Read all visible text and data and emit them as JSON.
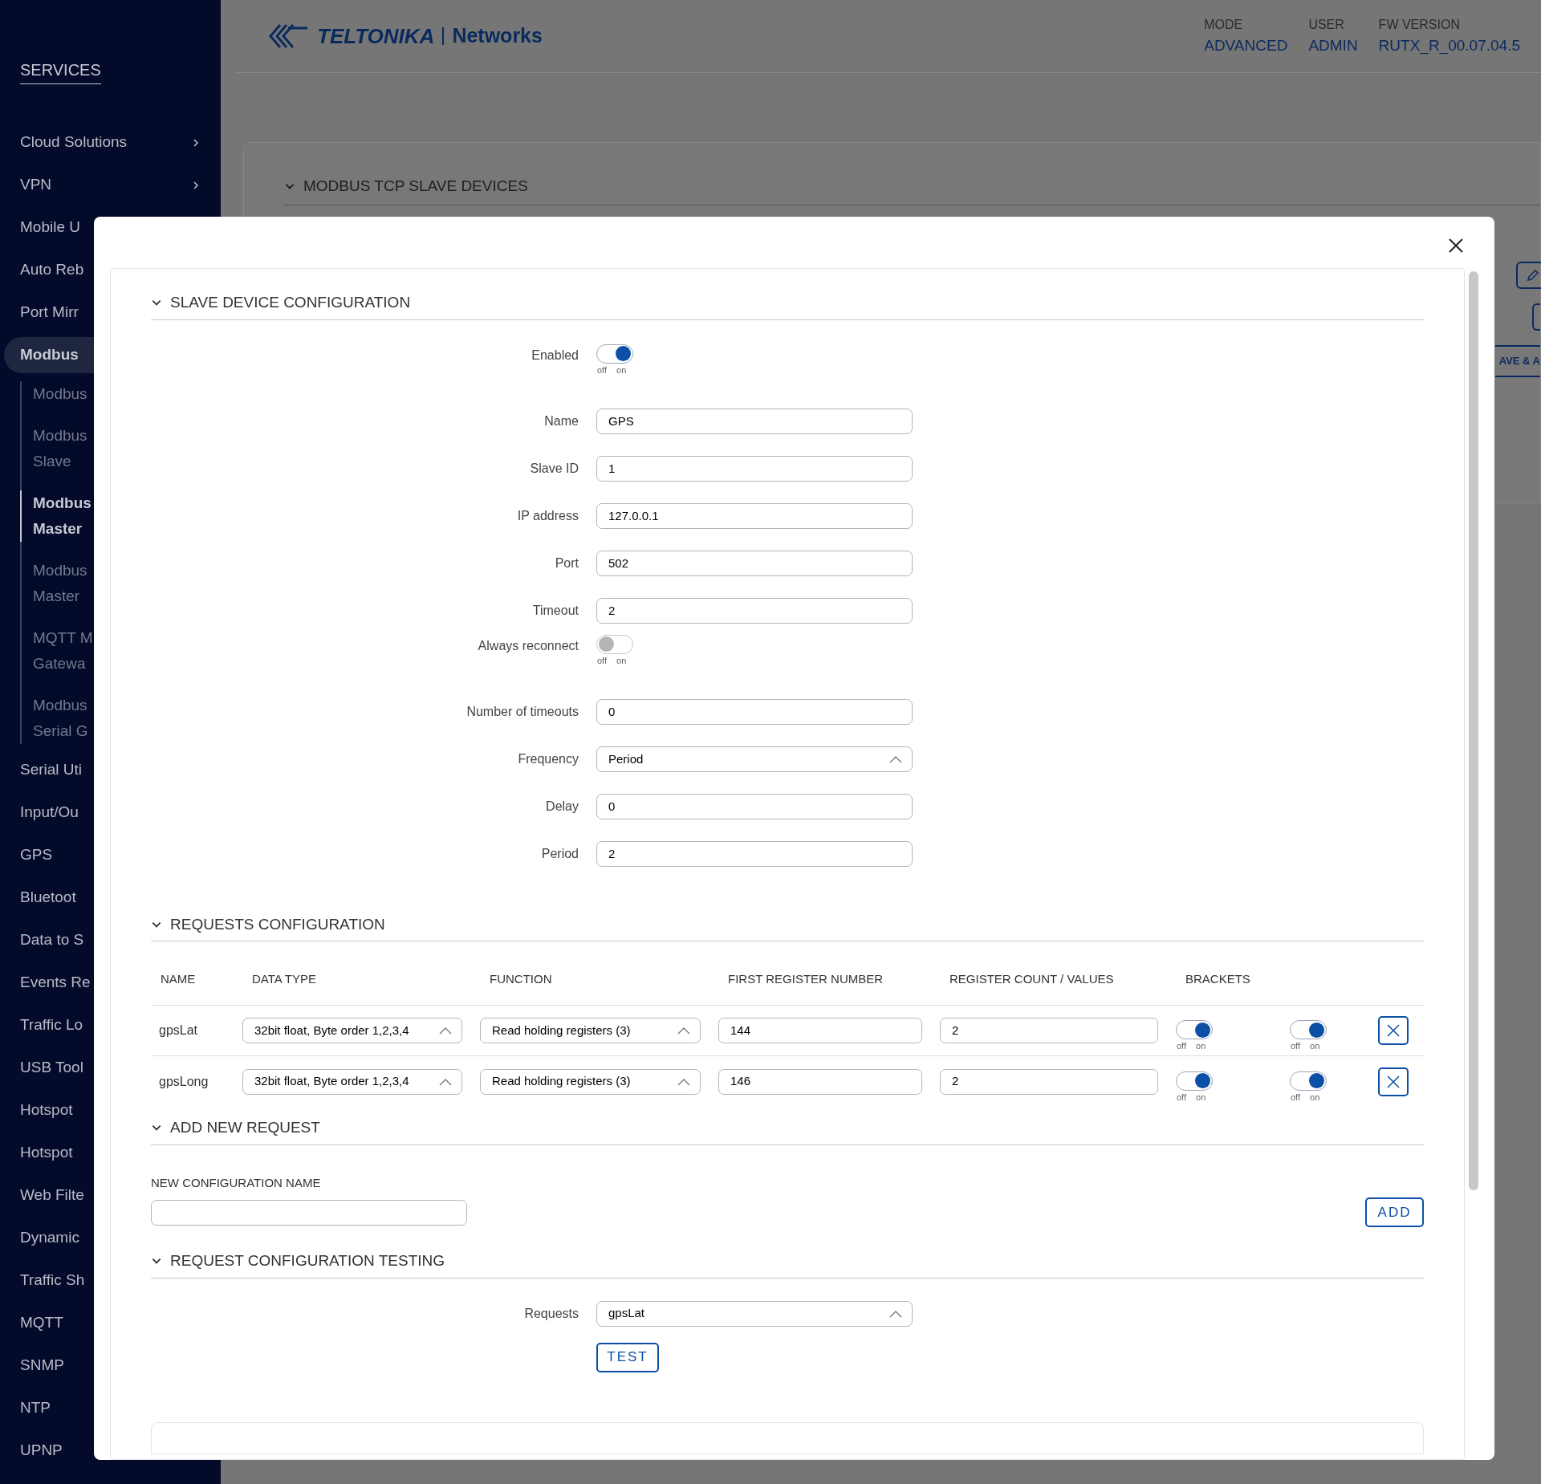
{
  "sidebar": {
    "section": "SERVICES",
    "items": [
      {
        "label": "Cloud Solutions",
        "chevron": true,
        "selected": false
      },
      {
        "label": "VPN",
        "chevron": true,
        "selected": false
      },
      {
        "label": "Mobile U",
        "selected": false
      },
      {
        "label": "Auto Reb",
        "selected": false
      },
      {
        "label": "Port Mirr",
        "selected": false
      },
      {
        "label": "Modbus",
        "selected": true,
        "children": [
          {
            "label": "Modbus",
            "selected": false
          },
          {
            "label": "Modbus\nSlave",
            "selected": false
          },
          {
            "label": "Modbus\nMaster",
            "selected": true
          },
          {
            "label": "Modbus\nMaster",
            "selected": false
          },
          {
            "label": "MQTT M\nGatewa",
            "selected": false
          },
          {
            "label": "Modbus\nSerial G",
            "selected": false
          }
        ]
      },
      {
        "label": "Serial Uti",
        "selected": false
      },
      {
        "label": "Input/Ou",
        "selected": false
      },
      {
        "label": "GPS",
        "selected": false
      },
      {
        "label": "Bluetoot",
        "selected": false
      },
      {
        "label": "Data to S",
        "selected": false
      },
      {
        "label": "Events Re",
        "selected": false
      },
      {
        "label": "Traffic Lo",
        "selected": false
      },
      {
        "label": "USB Tool",
        "selected": false
      },
      {
        "label": "Hotspot",
        "selected": false
      },
      {
        "label": "Hotspot",
        "selected": false
      },
      {
        "label": "Web Filte",
        "selected": false
      },
      {
        "label": "Dynamic",
        "selected": false
      },
      {
        "label": "Traffic Sh",
        "selected": false
      },
      {
        "label": "MQTT",
        "selected": false
      },
      {
        "label": "SNMP",
        "selected": false
      },
      {
        "label": "NTP",
        "selected": false
      },
      {
        "label": "UPNP",
        "selected": false
      }
    ]
  },
  "header": {
    "logo": {
      "brand": "TELTONIKA",
      "product": "Networks"
    },
    "info": [
      {
        "label": "MODE",
        "value": "ADVANCED"
      },
      {
        "label": "USER",
        "value": "ADMIN"
      },
      {
        "label": "FW VERSION",
        "value": "RUTX_R_00.07.04.5"
      }
    ]
  },
  "background_card": {
    "title": "MODBUS TCP SLAVE DEVICES",
    "expanded": true,
    "partial_button": "AVE & A"
  },
  "modal": {
    "slave_config": {
      "title": "SLAVE DEVICE CONFIGURATION",
      "expanded": true,
      "fields": [
        {
          "label": "Enabled",
          "kind": "toggle",
          "on": true,
          "off_label": "off",
          "on_label": "on"
        },
        {
          "label": "Name",
          "kind": "text",
          "value": "GPS"
        },
        {
          "label": "Slave ID",
          "kind": "text",
          "value": "1"
        },
        {
          "label": "IP address",
          "kind": "text",
          "value": "127.0.0.1"
        },
        {
          "label": "Port",
          "kind": "text",
          "value": "502"
        },
        {
          "label": "Timeout",
          "kind": "text",
          "value": "2"
        },
        {
          "label": "Always reconnect",
          "kind": "toggle",
          "on": false,
          "off_label": "off",
          "on_label": "on"
        },
        {
          "label": "Number of timeouts",
          "kind": "text",
          "value": "0"
        },
        {
          "label": "Frequency",
          "kind": "select",
          "value": "Period"
        },
        {
          "label": "Delay",
          "kind": "text",
          "value": "0"
        },
        {
          "label": "Period",
          "kind": "text",
          "value": "2"
        }
      ]
    },
    "requests": {
      "title": "REQUESTS CONFIGURATION",
      "expanded": true,
      "columns": [
        "NAME",
        "DATA TYPE",
        "FUNCTION",
        "FIRST REGISTER NUMBER",
        "REGISTER COUNT / VALUES",
        "BRACKETS"
      ],
      "rows": [
        {
          "name": "gpsLat",
          "data_type": "32bit float, Byte order 1,2,3,4",
          "function": "Read holding registers (3)",
          "first_register": "144",
          "register_count": "2",
          "brackets": {
            "on": true,
            "off_label": "off",
            "on_label": "on"
          },
          "column_7": {
            "on": true,
            "off_label": "off",
            "on_label": "on"
          }
        },
        {
          "name": "gpsLong",
          "data_type": "32bit float, Byte order 1,2,3,4",
          "function": "Read holding registers (3)",
          "first_register": "146",
          "register_count": "2",
          "brackets": {
            "on": true,
            "off_label": "off",
            "on_label": "on"
          },
          "column_7": {
            "on": true,
            "off_label": "off",
            "on_label": "on"
          }
        }
      ]
    },
    "add_new": {
      "title": "ADD NEW REQUEST",
      "expanded": true,
      "field_label": "NEW CONFIGURATION NAME",
      "button": "ADD"
    },
    "testing": {
      "title": "REQUEST CONFIGURATION TESTING",
      "expanded": true,
      "field_label": "Requests",
      "value": "gpsLat",
      "button": "TEST"
    }
  }
}
